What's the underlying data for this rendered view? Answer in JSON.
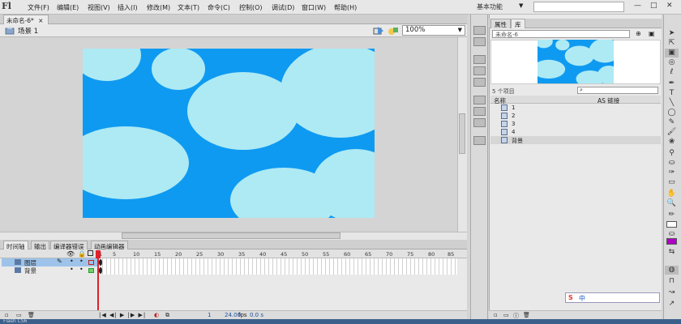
{
  "app": {
    "logo": "Fl",
    "workspace": "基本功能",
    "workspace_arrow": "▼"
  },
  "menu": [
    "文件(F)",
    "编辑(E)",
    "视图(V)",
    "插入(I)",
    "修改(M)",
    "文本(T)",
    "命令(C)",
    "控制(O)",
    "调试(D)",
    "窗口(W)",
    "帮助(H)"
  ],
  "window_buttons": {
    "minimize": "—",
    "maximize": "□",
    "close": "✕"
  },
  "document": {
    "tab": "未命名-6*",
    "tab_close": "×",
    "scene": "场景 1",
    "zoom": "100%",
    "zoom_arrow": "▼"
  },
  "timeline": {
    "tabs": [
      "时间轴",
      "输出",
      "编译器错误",
      "动画编辑器"
    ],
    "ruler": [
      "1",
      "5",
      "10",
      "15",
      "20",
      "25",
      "30",
      "35",
      "40",
      "45",
      "50",
      "55",
      "60",
      "65",
      "70",
      "75",
      "80",
      "85"
    ],
    "layers": [
      {
        "name": "图层"
      },
      {
        "name": "背景"
      }
    ],
    "footer": {
      "frame": "1",
      "fps": "24.00",
      "fps_label": "fps",
      "time": "0.0 s"
    }
  },
  "library": {
    "tabs": [
      "属性",
      "库"
    ],
    "document": "未命名-6",
    "count": "5 个项目",
    "header_name": "名称",
    "header_linkage": "AS 链接",
    "items": [
      {
        "name": "1"
      },
      {
        "name": "2"
      },
      {
        "name": "3"
      },
      {
        "name": "4"
      },
      {
        "name": "背景"
      }
    ]
  },
  "ime": {
    "logo": "S",
    "mode": "中"
  },
  "taskbar": {
    "text": "Flash CS6"
  },
  "colors": {
    "stage_bg": "#0f9af1",
    "ellipse": "#aeeaf4",
    "layer_selected": "#9dc3ea",
    "playhead": "#e0202a"
  }
}
